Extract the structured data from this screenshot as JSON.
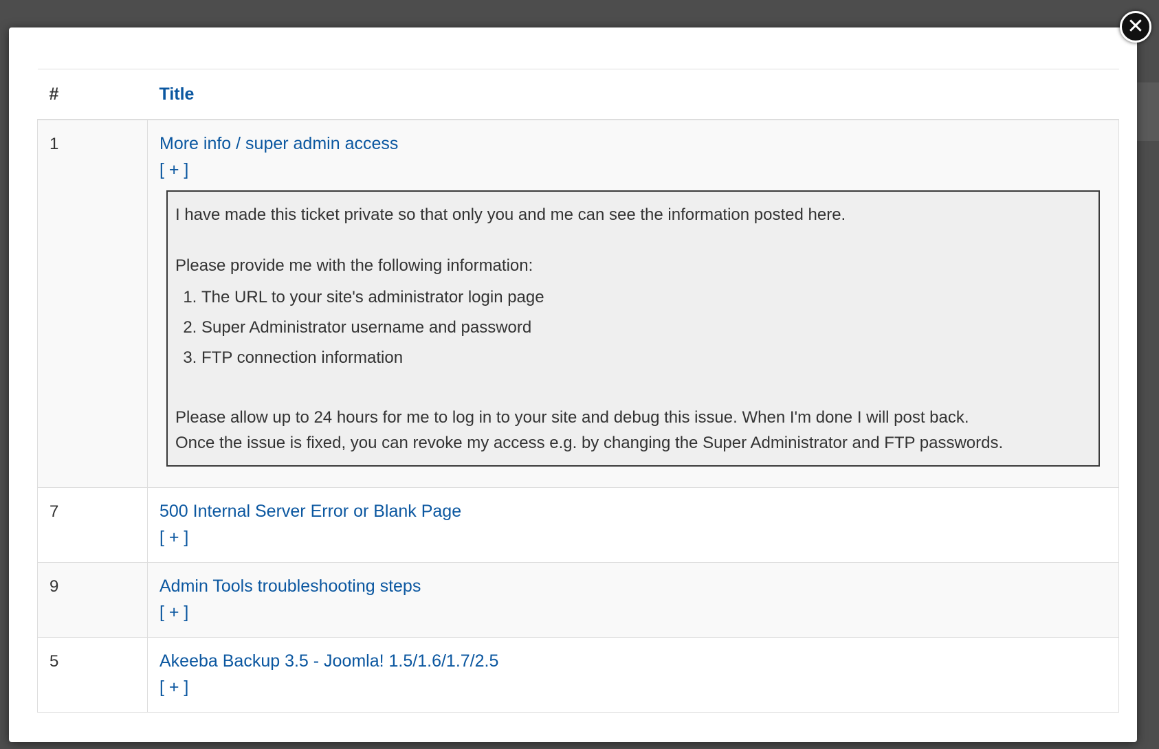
{
  "modal": {
    "table": {
      "headers": {
        "number": "#",
        "title": "Title"
      },
      "toggle_label": "[ + ]",
      "rows": [
        {
          "number": "1",
          "title": "More info / super admin access",
          "expanded": true,
          "detail": {
            "intro": "I have made this ticket private so that only you and me can see the information posted here.",
            "request": "Please provide me with the following information:",
            "items": [
              "The URL to your site's administrator login page",
              "Super Administrator username and password",
              "FTP connection information"
            ],
            "closing_1": "Please allow up to 24 hours for me to log in to your site and debug this issue. When I'm done I will post back.",
            "closing_2": "Once the issue is fixed, you can revoke my access e.g. by changing the Super Administrator and FTP passwords."
          }
        },
        {
          "number": "7",
          "title": "500 Internal Server Error or Blank Page",
          "expanded": false
        },
        {
          "number": "9",
          "title": "Admin Tools troubleshooting steps",
          "expanded": false
        },
        {
          "number": "5",
          "title": "Akeeba Backup 3.5 - Joomla! 1.5/1.6/1.7/2.5",
          "expanded": false
        }
      ]
    },
    "close_icon": "close-icon"
  },
  "colors": {
    "link": "#0b57a0",
    "overlay": "#4d4d4d",
    "row_stripe": "#f9f9f9",
    "detail_background": "#efefef"
  }
}
